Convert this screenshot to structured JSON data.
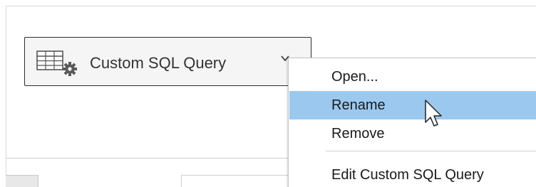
{
  "datasource": {
    "label": "Custom SQL Query",
    "icon": "table-gear-icon",
    "dropdown_icon": "chevron-down-icon"
  },
  "context_menu": {
    "items": [
      {
        "label": "Open...",
        "highlighted": false
      },
      {
        "label": "Rename",
        "highlighted": true
      },
      {
        "label": "Remove",
        "highlighted": false
      },
      {
        "label": "Edit Custom SQL Query",
        "highlighted": false
      }
    ]
  },
  "colors": {
    "highlight": "#9bc8ef",
    "pill_border": "#2d2d2d",
    "pill_background": "#f5f5f5",
    "text": "#1a1a1a"
  }
}
